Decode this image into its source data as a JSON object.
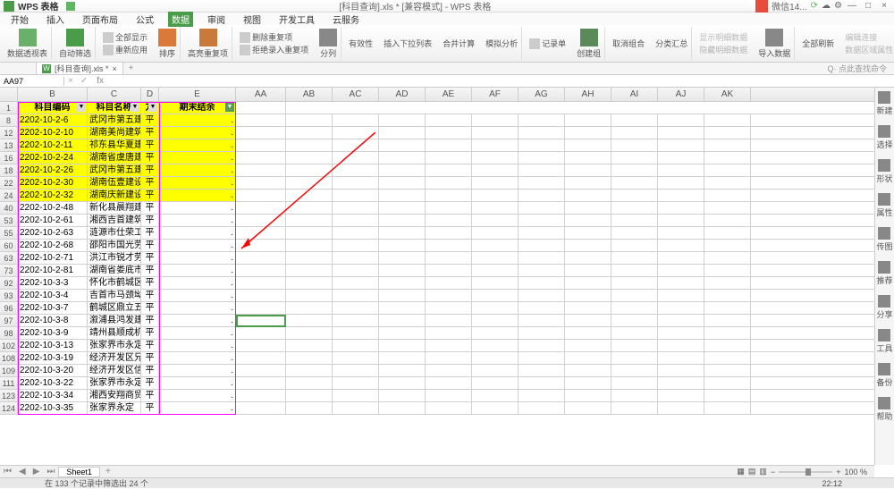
{
  "app": {
    "title": "WPS 表格",
    "center_doc": "[科目查询].xls * [兼容模式] - WPS 表格"
  },
  "titlebar_right": {
    "wechat": "微信14...",
    "time": "22:12"
  },
  "ribbon_tabs": [
    "开始",
    "插入",
    "页面布局",
    "公式",
    "数据",
    "审阅",
    "视图",
    "开发工具",
    "云服务"
  ],
  "ribbon_active": 4,
  "ribbon": {
    "pivot": "数据透视表",
    "auto": "自动筛选",
    "reapply": "重新应用",
    "all_show": "全部显示",
    "sort": "排序",
    "highlight": "高亮重复项",
    "del_dup": "删除重复项",
    "reject_dup": "拒绝录入重复项",
    "split": "分列",
    "validate": "有效性",
    "insert_dd": "插入下拉列表",
    "consolidate": "合并计算",
    "simulate": "模拟分析",
    "record": "记录单",
    "group": "创建组",
    "ungroup": "取消组合",
    "subtotal": "分类汇总",
    "show_detail": "显示明细数据",
    "hide_detail": "隐藏明细数据",
    "import": "导入数据",
    "refresh": "全部刷新",
    "edit_link": "编辑连接",
    "data_region": "数据区域属性"
  },
  "doctab": {
    "name": "[科目查询].xls *",
    "search": "Q· 点此查找命令"
  },
  "fbar": {
    "name": "AA97",
    "fx": "fx"
  },
  "columns": [
    "B",
    "C",
    "D",
    "E",
    "AA",
    "AB",
    "AC",
    "AD",
    "AE",
    "AF",
    "AG",
    "AH",
    "AI",
    "AJ",
    "AK"
  ],
  "header_row": {
    "num": "1",
    "b": "科目编码",
    "c": "科目名称",
    "d": "方",
    "e": "期末结余"
  },
  "rows": [
    {
      "n": "8",
      "b": "2202-10-2-6",
      "c": "武冈市第五建",
      "d": "平",
      "y": true
    },
    {
      "n": "12",
      "b": "2202-10-2-10",
      "c": "湖南美尚建筑",
      "d": "平",
      "y": true
    },
    {
      "n": "13",
      "b": "2202-10-2-11",
      "c": "祁东县华夏建",
      "d": "平",
      "y": true
    },
    {
      "n": "16",
      "b": "2202-10-2-24",
      "c": "湖南省虞唐建",
      "d": "平",
      "y": true
    },
    {
      "n": "18",
      "b": "2202-10-2-26",
      "c": "武冈市第五建",
      "d": "平",
      "y": true
    },
    {
      "n": "22",
      "b": "2202-10-2-30",
      "c": "湖南伍壹建设",
      "d": "平",
      "y": true
    },
    {
      "n": "24",
      "b": "2202-10-2-32",
      "c": "湖南庆新建设",
      "d": "平",
      "y": true
    },
    {
      "n": "40",
      "b": "2202-10-2-48",
      "c": "新化县晨翔建",
      "d": "平",
      "y": false
    },
    {
      "n": "53",
      "b": "2202-10-2-61",
      "c": "湘西吉首建筑",
      "d": "平",
      "y": false
    },
    {
      "n": "55",
      "b": "2202-10-2-63",
      "c": "涟源市仕荣工",
      "d": "平",
      "y": false
    },
    {
      "n": "60",
      "b": "2202-10-2-68",
      "c": "邵阳市国光劳",
      "d": "平",
      "y": false
    },
    {
      "n": "63",
      "b": "2202-10-2-71",
      "c": "洪江市锐才劳",
      "d": "平",
      "y": false
    },
    {
      "n": "73",
      "b": "2202-10-2-81",
      "c": "湖南省娄底市",
      "d": "平",
      "y": false
    },
    {
      "n": "92",
      "b": "2202-10-3-3",
      "c": "怀化市鹤城区",
      "d": "平",
      "y": false
    },
    {
      "n": "93",
      "b": "2202-10-3-4",
      "c": "吉首市马颈坳",
      "d": "平",
      "y": false
    },
    {
      "n": "96",
      "b": "2202-10-3-7",
      "c": "鹤城区鼎立五",
      "d": "平",
      "y": false
    },
    {
      "n": "97",
      "b": "2202-10-3-8",
      "c": "溆浦县鸿发建",
      "d": "平",
      "y": false
    },
    {
      "n": "98",
      "b": "2202-10-3-9",
      "c": "靖州县顺成机",
      "d": "平",
      "y": false
    },
    {
      "n": "102",
      "b": "2202-10-3-13",
      "c": "张家界市永定",
      "d": "平",
      "y": false
    },
    {
      "n": "108",
      "b": "2202-10-3-19",
      "c": "经济开发区兄",
      "d": "平",
      "y": false
    },
    {
      "n": "109",
      "b": "2202-10-3-20",
      "c": "经济开发区信",
      "d": "平",
      "y": false
    },
    {
      "n": "111",
      "b": "2202-10-3-22",
      "c": "张家界市永定",
      "d": "平",
      "y": false
    },
    {
      "n": "123",
      "b": "2202-10-3-34",
      "c": "湘西安翔商贸",
      "d": "平",
      "y": false
    },
    {
      "n": "124",
      "b": "2202-10-3-35",
      "c": "张家界永定",
      "d": "平",
      "y": false
    }
  ],
  "right_panel": [
    "新建",
    "选择",
    "形状",
    "属性",
    "传图",
    "推荐",
    "分享",
    "工具",
    "备份",
    "帮助"
  ],
  "sheet": {
    "name": "Sheet1",
    "zoom": "100 %"
  },
  "status": {
    "text": "在 133 个记录中筛选出 24 个"
  },
  "chart_data": null
}
